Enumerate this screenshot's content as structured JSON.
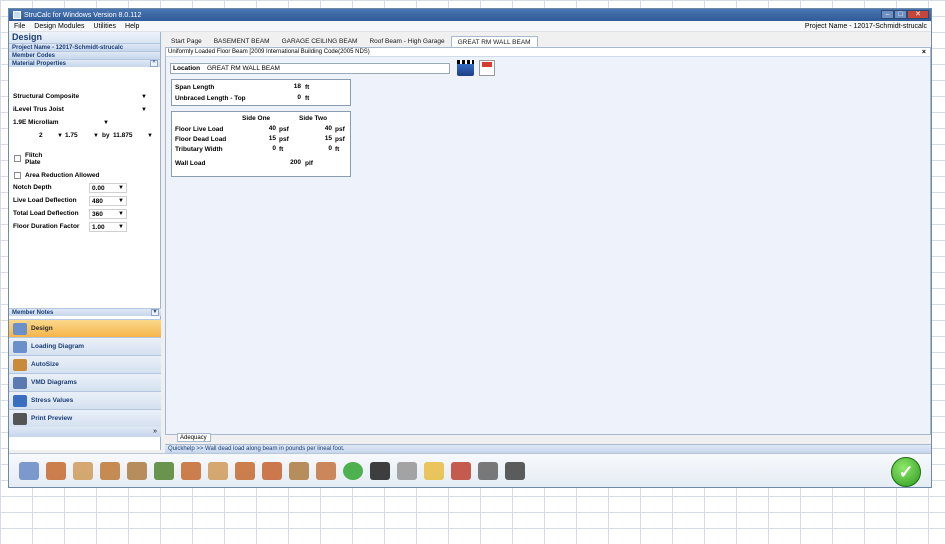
{
  "window": {
    "title": "StruCalc for Windows Version 8.0.112",
    "controls": [
      "–",
      "□",
      "✕"
    ]
  },
  "menu": {
    "items": [
      "File",
      "Design Modules",
      "Utilities",
      "Help"
    ],
    "project_name": "Project Name - 12017-Schmidt-strucalc"
  },
  "sidebar": {
    "title": "Design",
    "project_strip": "Project Name - 12017-Schmidt-strucalc",
    "member_codes": "Member Codes",
    "material_properties": "Material Properties",
    "collapse_glyph": "^",
    "material": "Structural Composite",
    "product": "iLevel Trus Joist",
    "grade": "1.9E Microllam",
    "plies": "2",
    "width": "1.75",
    "by_label": "by",
    "depth": "11.875",
    "flitch_plate": "Flitch Plate",
    "area_reduction": "Area Reduction Allowed",
    "notch_depth_label": "Notch Depth",
    "notch_depth_value": "0.00",
    "live_load_defl_label": "Live Load Deflection",
    "live_load_defl_value": "480",
    "total_load_defl_label": "Total Load Deflection",
    "total_load_defl_value": "360",
    "floor_duration_label": "Floor Duration Factor",
    "floor_duration_value": "1.00",
    "member_notes": "Member Notes",
    "expand_glyph": "»"
  },
  "nav": {
    "items": [
      {
        "label": "Design",
        "icon": "design-icon",
        "color": "#6a8fc9",
        "active": true
      },
      {
        "label": "Loading Diagram",
        "icon": "loading-diagram-icon",
        "color": "#6a8fc9",
        "active": false
      },
      {
        "label": "AutoSize",
        "icon": "autosize-icon",
        "color": "#c98a3a",
        "active": false
      },
      {
        "label": "VMD Diagrams",
        "icon": "vmd-icon",
        "color": "#5a7ab0",
        "active": false
      },
      {
        "label": "Stress Values",
        "icon": "stress-icon",
        "color": "#3a6fc0",
        "active": false
      },
      {
        "label": "Print Preview",
        "icon": "print-preview-icon",
        "color": "#555555",
        "active": false
      }
    ]
  },
  "tabs": [
    "Start Page",
    "BASEMENT BEAM",
    "GARAGE CEILING BEAM",
    "Roof Beam - High Garage",
    "GREAT RM WALL BEAM"
  ],
  "content": {
    "header": "Uniformly Loaded Floor Beam [2009 International Building Code(2005 NDS)",
    "close_glyph": "×",
    "location_label": "Location",
    "location_value": "GREAT RM WALL BEAM",
    "span_length_label": "Span Length",
    "span_length_value": "18",
    "span_unit": "ft",
    "unbraced_label": "Unbraced Length - Top",
    "unbraced_value": "0",
    "unbraced_unit": "ft",
    "side_one": "Side One",
    "side_two": "Side Two",
    "floor_live_label": "Floor Live Load",
    "floor_live_1": "40",
    "floor_live_2": "40",
    "floor_dead_label": "Floor Dead Load",
    "floor_dead_1": "15",
    "floor_dead_2": "15",
    "trib_label": "Tributary Width",
    "trib_1": "0",
    "trib_2": "0",
    "psf": "psf",
    "ft": "ft",
    "wall_load_label": "Wall Load",
    "wall_load_value": "200",
    "wall_load_unit": "plf"
  },
  "adequacy_tab": "Adequacy",
  "quickhelp": "Quickhelp >> Wall dead load along beam in pounds per lineal foot.",
  "toolbar": {
    "icons": [
      {
        "name": "beam-icon",
        "color": "#6f8fc8"
      },
      {
        "name": "joist-icon",
        "color": "#c8713a"
      },
      {
        "name": "rafter-icon",
        "color": "#d0a060"
      },
      {
        "name": "truss-icon",
        "color": "#c08040"
      },
      {
        "name": "framing-icon",
        "color": "#b0824a"
      },
      {
        "name": "column-icon",
        "color": "#5a8a3a"
      },
      {
        "name": "header-icon",
        "color": "#c8713a"
      },
      {
        "name": "ridge-icon",
        "color": "#d0a060"
      },
      {
        "name": "floor-beam-icon",
        "color": "#c8713a"
      },
      {
        "name": "hip-icon",
        "color": "#c86a3a"
      },
      {
        "name": "house-frame-icon",
        "color": "#b0824a"
      },
      {
        "name": "roof-icon",
        "color": "#c87a4a"
      },
      {
        "name": "stop-icon",
        "color": "#3caa3c"
      },
      {
        "name": "save-icon",
        "color": "#2a2a2a"
      },
      {
        "name": "settings-icon",
        "color": "#9a9a9a"
      },
      {
        "name": "folder-icon",
        "color": "#e8c04a"
      },
      {
        "name": "tools-icon",
        "color": "#c04a3a"
      },
      {
        "name": "calculator-icon",
        "color": "#6a6a6a"
      },
      {
        "name": "print-icon",
        "color": "#4a4a4a"
      }
    ],
    "ok": "✓"
  }
}
